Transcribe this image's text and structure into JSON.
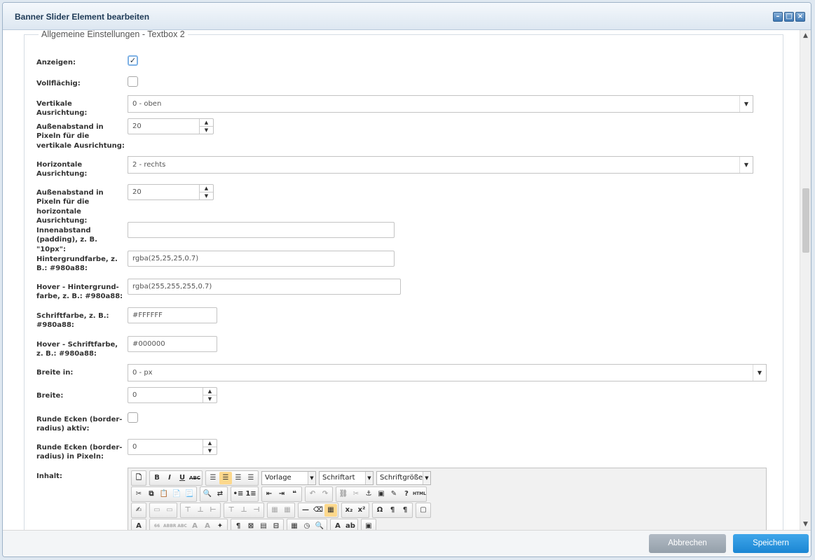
{
  "window": {
    "title": "Banner Slider Element bearbeiten",
    "controls": [
      "minimize-icon",
      "maximize-icon",
      "close-icon"
    ]
  },
  "section": {
    "legend": "Allgemeine Einstellungen - Textbox 2"
  },
  "form": {
    "show_label": "Anzeigen:",
    "show_checked": true,
    "fullwidth_label": "Vollflächig:",
    "valign_label": "Vertikale Ausrichtung:",
    "valign_value": "0 - oben",
    "vmargin_label": "Außenabstand in Pixeln für die vertikale Ausrichtung:",
    "vmargin_value": "20",
    "halign_label": "Horizontale Ausrichtung:",
    "halign_value": "2 - rechts",
    "hmargin_label": "Außenabstand in Pixeln für die horizontale Ausrichtung:",
    "hmargin_value": "20",
    "padding_label": "Innenabstand (padding), z. B. \"10px\":",
    "padding_value": "",
    "bg_label": "Hintergrundfarbe, z. B.: #980a88:",
    "bg_value": "rgba(25,25,25,0.7)",
    "hoverbg_label": "Hover - Hintergrund-farbe, z. B.: #980a88:",
    "hoverbg_value": "rgba(255,255,255,0.7)",
    "font_label": "Schriftfarbe, z. B.: #980a88:",
    "font_value": "#FFFFFF",
    "hoverfont_label": "Hover - Schriftfarbe, z. B.: #980a88:",
    "hoverfont_value": "#000000",
    "widthunit_label": "Breite in:",
    "widthunit_value": "0 - px",
    "width_label": "Breite:",
    "width_value": "0",
    "radius_active_label": "Runde Ecken (border-radius) aktiv:",
    "radius_px_label": "Runde Ecken (border-radius) in Pixeln:",
    "radius_px_value": "0",
    "content_label": "Inhalt:"
  },
  "editor": {
    "format_combo": "Vorlage",
    "font_combo": "Schriftart",
    "size_combo": "Schriftgröße"
  },
  "footer": {
    "cancel_label": "Abbrechen",
    "save_label": "Speichern"
  },
  "colors": {
    "save": "#1b86d3",
    "cancel": "#949faa",
    "title": "#1e3a56"
  }
}
